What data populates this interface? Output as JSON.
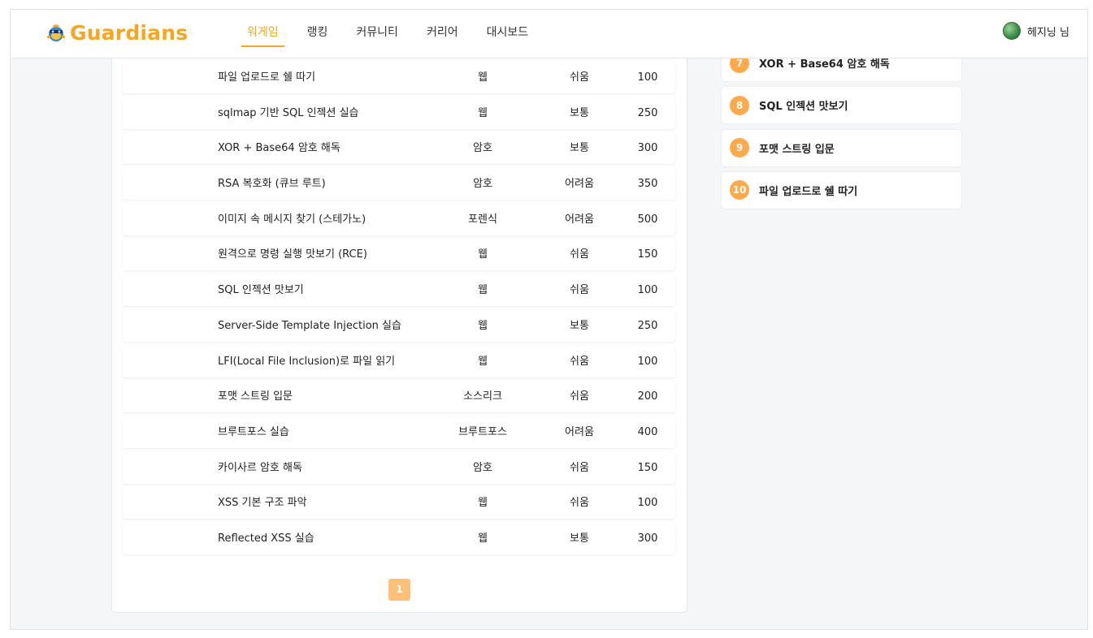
{
  "brand": {
    "name": "Guardians",
    "accent": "#f5a623"
  },
  "nav": {
    "items": [
      {
        "label": "워게임",
        "active": true
      },
      {
        "label": "랭킹",
        "active": false
      },
      {
        "label": "커뮤니티",
        "active": false
      },
      {
        "label": "커리어",
        "active": false
      },
      {
        "label": "대시보드",
        "active": false
      }
    ]
  },
  "user": {
    "name": "헤지닝 님"
  },
  "problems": [
    {
      "title": "파일 업로드로 쉘 따기",
      "category": "웹",
      "difficulty": "쉬움",
      "score": "100"
    },
    {
      "title": "sqlmap 기반 SQL 인젝션 실습",
      "category": "웹",
      "difficulty": "보통",
      "score": "250"
    },
    {
      "title": "XOR + Base64 암호 해독",
      "category": "암호",
      "difficulty": "보통",
      "score": "300"
    },
    {
      "title": "RSA 복호화 (큐브 루트)",
      "category": "암호",
      "difficulty": "어려움",
      "score": "350"
    },
    {
      "title": "이미지 속 메시지 찾기 (스테가노)",
      "category": "포렌식",
      "difficulty": "어려움",
      "score": "500"
    },
    {
      "title": "원격으로 명령 실행 맛보기 (RCE)",
      "category": "웹",
      "difficulty": "쉬움",
      "score": "150"
    },
    {
      "title": "SQL 인젝션 맛보기",
      "category": "웹",
      "difficulty": "쉬움",
      "score": "100"
    },
    {
      "title": "Server-Side Template Injection 실습",
      "category": "웹",
      "difficulty": "보통",
      "score": "250"
    },
    {
      "title": "LFI(Local File Inclusion)로 파일 읽기",
      "category": "웹",
      "difficulty": "쉬움",
      "score": "100"
    },
    {
      "title": "포맷 스트링 입문",
      "category": "소스리크",
      "difficulty": "쉬움",
      "score": "200"
    },
    {
      "title": "브루트포스 실습",
      "category": "브루트포스",
      "difficulty": "어려움",
      "score": "400"
    },
    {
      "title": "카이사르 암호 해독",
      "category": "암호",
      "difficulty": "쉬움",
      "score": "150"
    },
    {
      "title": "XSS 기본 구조 파악",
      "category": "웹",
      "difficulty": "쉬움",
      "score": "100"
    },
    {
      "title": "Reflected XSS 실습",
      "category": "웹",
      "difficulty": "보통",
      "score": "300"
    }
  ],
  "pagination": {
    "current": "1"
  },
  "side_list": [
    {
      "rank": "7",
      "title": "XOR + Base64 암호 해독"
    },
    {
      "rank": "8",
      "title": "SQL 인젝션 맛보기"
    },
    {
      "rank": "9",
      "title": "포맷 스트링 입문"
    },
    {
      "rank": "10",
      "title": "파일 업로드로 쉘 따기"
    }
  ]
}
